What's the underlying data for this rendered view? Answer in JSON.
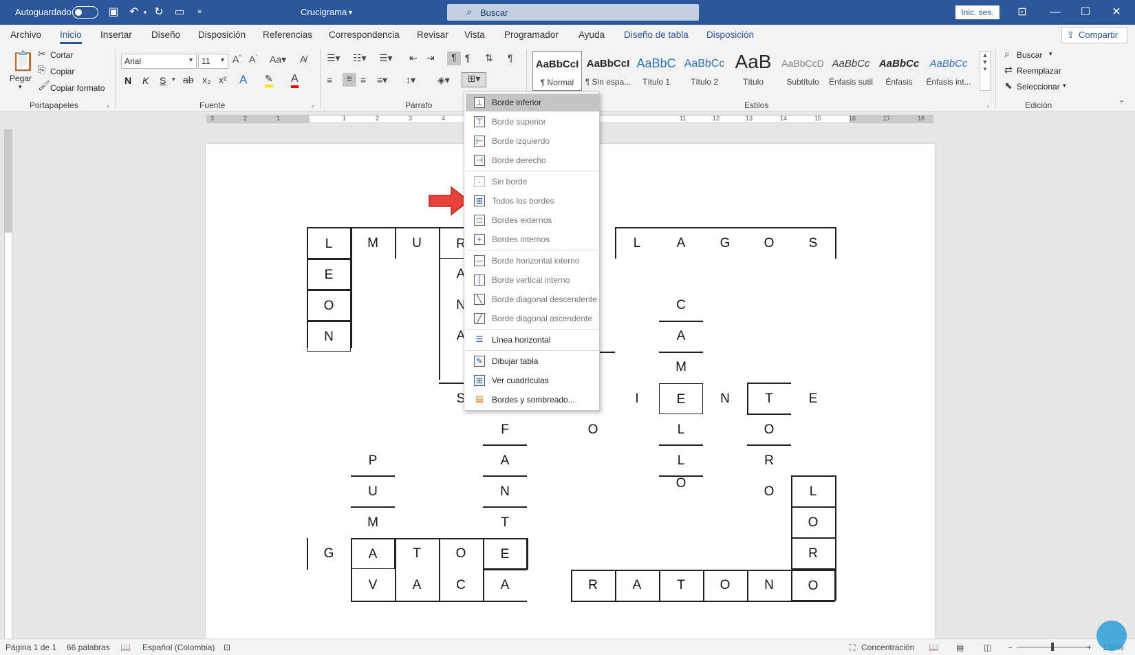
{
  "titlebar": {
    "autosave_label": "Autoguardado",
    "doc_title": "Crucigrama",
    "search_label": "Buscar",
    "signin_label": "Inic. ses."
  },
  "tabs": [
    "Archivo",
    "Inicio",
    "Insertar",
    "Diseño",
    "Disposición",
    "Referencias",
    "Correspondencia",
    "Revisar",
    "Vista",
    "Programador",
    "Ayuda",
    "Diseño de tabla",
    "Disposición"
  ],
  "share_label": "Compartir",
  "ribbon": {
    "clipboard": {
      "paste": "Pegar",
      "cut": "Cortar",
      "copy": "Copiar",
      "format_painter": "Copiar formato",
      "label": "Portapapeles"
    },
    "font": {
      "name": "Arial",
      "size": "11",
      "label": "Fuente",
      "bold": "N",
      "italic": "K",
      "underline": "S"
    },
    "paragraph": {
      "label": "Párrafo"
    },
    "styles": {
      "label": "Estilos",
      "items": [
        {
          "sample": "AaBbCcI",
          "name": "¶ Normal"
        },
        {
          "sample": "AaBbCcI",
          "name": "¶ Sin espa..."
        },
        {
          "sample": "AaBbC",
          "name": "Título 1"
        },
        {
          "sample": "AaBbCc",
          "name": "Título 2"
        },
        {
          "sample": "AaB",
          "name": "Título"
        },
        {
          "sample": "AaBbCcD",
          "name": "Subtítulo"
        },
        {
          "sample": "AaBbCc",
          "name": "Énfasis sutil"
        },
        {
          "sample": "AaBbCc",
          "name": "Énfasis"
        },
        {
          "sample": "AaBbCc",
          "name": "Énfasis int..."
        }
      ]
    },
    "editing": {
      "label": "Edición",
      "find": "Buscar",
      "replace": "Reemplazar",
      "select": "Seleccionar"
    }
  },
  "ruler_numbers": [
    "3",
    "2",
    "1",
    "1",
    "2",
    "3",
    "4",
    "11",
    "12",
    "13",
    "14",
    "15",
    "16",
    "17",
    "18"
  ],
  "crossword": {
    "cells": [
      {
        "t": "L"
      },
      {
        "t": "M"
      },
      {
        "t": "U"
      },
      {
        "t": "R"
      },
      {
        "t": "L"
      },
      {
        "t": "A"
      },
      {
        "t": "G"
      },
      {
        "t": "O"
      },
      {
        "t": "S"
      },
      {
        "t": "E"
      },
      {
        "t": "A"
      },
      {
        "t": "O"
      },
      {
        "t": "N"
      },
      {
        "t": "C"
      },
      {
        "t": "N"
      },
      {
        "t": "A"
      },
      {
        "t": "A"
      },
      {
        "t": "M"
      },
      {
        "t": "S"
      },
      {
        "t": "I"
      },
      {
        "t": "E"
      },
      {
        "t": "N"
      },
      {
        "t": "T"
      },
      {
        "t": "E"
      },
      {
        "t": "F"
      },
      {
        "t": "O"
      },
      {
        "t": "L"
      },
      {
        "t": "O"
      },
      {
        "t": "P"
      },
      {
        "t": "A"
      },
      {
        "t": "L"
      },
      {
        "t": "R"
      },
      {
        "t": "O"
      },
      {
        "t": "U"
      },
      {
        "t": "N"
      },
      {
        "t": "O"
      },
      {
        "t": "L"
      },
      {
        "t": "M"
      },
      {
        "t": "T"
      },
      {
        "t": "O"
      },
      {
        "t": "G"
      },
      {
        "t": "A"
      },
      {
        "t": "T"
      },
      {
        "t": "O"
      },
      {
        "t": "E"
      },
      {
        "t": "R"
      },
      {
        "t": "V"
      },
      {
        "t": "A"
      },
      {
        "t": "C"
      },
      {
        "t": "A"
      },
      {
        "t": "R"
      },
      {
        "t": "A"
      },
      {
        "t": "T"
      },
      {
        "t": "O"
      },
      {
        "t": "N"
      },
      {
        "t": "O"
      }
    ]
  },
  "border_menu": [
    "Borde inferior",
    "Borde superior",
    "Borde izquierdo",
    "Borde derecho",
    "Sin borde",
    "Todos los bordes",
    "Bordes externos",
    "Bordes internos",
    "Borde horizontal interno",
    "Borde vertical interno",
    "Borde diagonal descendente",
    "Borde diagonal ascendente",
    "Línea horizontal",
    "Dibujar tabla",
    "Ver cuadrículas",
    "Bordes y sombreado..."
  ],
  "status": {
    "page": "Página 1 de 1",
    "words": "66 palabras",
    "language": "Español (Colombia)",
    "focus": "Concentración",
    "zoom": "130%"
  },
  "colors": {
    "accent": "#2b579a",
    "arrow": "#e8423c"
  }
}
